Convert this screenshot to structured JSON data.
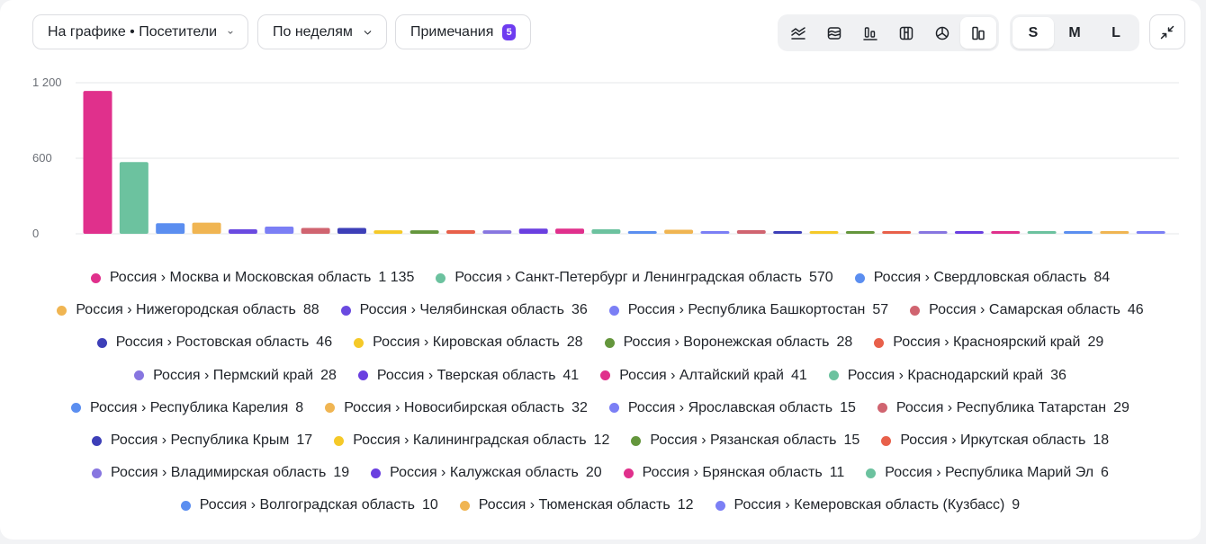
{
  "toolbar": {
    "metric_dropdown": "На графике • Посетители",
    "period_dropdown": "По неделям",
    "notes_label": "Примечания",
    "notes_count": "5",
    "chart_types": [
      "line-chart-icon",
      "area-chart-icon",
      "bar-chart-icon",
      "stacked-chart-icon",
      "pie-chart-icon",
      "column-chart-icon"
    ],
    "active_chart_type": 5,
    "sizes": [
      "S",
      "M",
      "L"
    ],
    "active_size": 0
  },
  "colors": {
    "pink": "#e0308c",
    "teal": "#6cc29f",
    "blue": "#5b8ef0",
    "orange": "#f0b552",
    "purple": "#6a4ae0",
    "periwinkle": "#7b7ff5",
    "rose": "#d06470",
    "navy": "#3d3fb8",
    "yellow": "#f5c928",
    "green": "#64963c",
    "red": "#e8604a",
    "lavender": "#8776e0",
    "violet": "#6a3fe0",
    "grid": "#e6e7ea",
    "axis_text": "#6b6f76"
  },
  "chart_data": {
    "type": "bar",
    "ylim": [
      0,
      1200
    ],
    "yticks": [
      "0",
      "600",
      "1 200"
    ],
    "ytick_values": [
      0,
      600,
      1200
    ],
    "grid": true,
    "legend_position": "bottom",
    "series": [
      {
        "name": "Россия › Москва и Московская область",
        "value": 1135,
        "value_label": "1 135",
        "color": "#e0308c"
      },
      {
        "name": "Россия › Санкт-Петербург и Ленинградская область",
        "value": 570,
        "value_label": "570",
        "color": "#6cc29f"
      },
      {
        "name": "Россия › Свердловская область",
        "value": 84,
        "value_label": "84",
        "color": "#5b8ef0"
      },
      {
        "name": "Россия › Нижегородская область",
        "value": 88,
        "value_label": "88",
        "color": "#f0b552"
      },
      {
        "name": "Россия › Челябинская область",
        "value": 36,
        "value_label": "36",
        "color": "#6a4ae0"
      },
      {
        "name": "Россия › Республика Башкортостан",
        "value": 57,
        "value_label": "57",
        "color": "#7b7ff5"
      },
      {
        "name": "Россия › Самарская область",
        "value": 46,
        "value_label": "46",
        "color": "#d06470"
      },
      {
        "name": "Россия › Ростовская область",
        "value": 46,
        "value_label": "46",
        "color": "#3d3fb8"
      },
      {
        "name": "Россия › Кировская область",
        "value": 28,
        "value_label": "28",
        "color": "#f5c928"
      },
      {
        "name": "Россия › Воронежская область",
        "value": 28,
        "value_label": "28",
        "color": "#64963c"
      },
      {
        "name": "Россия › Красноярский край",
        "value": 29,
        "value_label": "29",
        "color": "#e8604a"
      },
      {
        "name": "Россия › Пермский край",
        "value": 28,
        "value_label": "28",
        "color": "#8776e0"
      },
      {
        "name": "Россия › Тверская область",
        "value": 41,
        "value_label": "41",
        "color": "#6a3fe0"
      },
      {
        "name": "Россия › Алтайский край",
        "value": 41,
        "value_label": "41",
        "color": "#e0308c"
      },
      {
        "name": "Россия › Краснодарский край",
        "value": 36,
        "value_label": "36",
        "color": "#6cc29f"
      },
      {
        "name": "Россия › Республика Карелия",
        "value": 8,
        "value_label": "8",
        "color": "#5b8ef0"
      },
      {
        "name": "Россия › Новосибирская область",
        "value": 32,
        "value_label": "32",
        "color": "#f0b552"
      },
      {
        "name": "Россия › Ярославская область",
        "value": 15,
        "value_label": "15",
        "color": "#7b7ff5"
      },
      {
        "name": "Россия › Республика Татарстан",
        "value": 29,
        "value_label": "29",
        "color": "#d06470"
      },
      {
        "name": "Россия › Республика Крым",
        "value": 17,
        "value_label": "17",
        "color": "#3d3fb8"
      },
      {
        "name": "Россия › Калининградская область",
        "value": 12,
        "value_label": "12",
        "color": "#f5c928"
      },
      {
        "name": "Россия › Рязанская область",
        "value": 15,
        "value_label": "15",
        "color": "#64963c"
      },
      {
        "name": "Россия › Иркутская область",
        "value": 18,
        "value_label": "18",
        "color": "#e8604a"
      },
      {
        "name": "Россия › Владимирская область",
        "value": 19,
        "value_label": "19",
        "color": "#8776e0"
      },
      {
        "name": "Россия › Калужская область",
        "value": 20,
        "value_label": "20",
        "color": "#6a3fe0"
      },
      {
        "name": "Россия › Брянская область",
        "value": 11,
        "value_label": "11",
        "color": "#e0308c"
      },
      {
        "name": "Россия › Республика Марий Эл",
        "value": 6,
        "value_label": "6",
        "color": "#6cc29f"
      },
      {
        "name": "Россия › Волгоградская область",
        "value": 10,
        "value_label": "10",
        "color": "#5b8ef0"
      },
      {
        "name": "Россия › Тюменская область",
        "value": 12,
        "value_label": "12",
        "color": "#f0b552"
      },
      {
        "name": "Россия › Кемеровская область (Кузбасс)",
        "value": 9,
        "value_label": "9",
        "color": "#7b7ff5"
      }
    ],
    "legend_rows": [
      [
        0,
        1,
        2
      ],
      [
        3,
        4,
        5,
        6
      ],
      [
        7,
        8,
        9,
        10
      ],
      [
        11,
        12,
        13,
        14
      ],
      [
        15,
        16,
        17,
        18
      ],
      [
        19,
        20,
        21,
        22
      ],
      [
        23,
        24,
        25,
        26
      ],
      [
        27,
        28,
        29
      ]
    ]
  }
}
